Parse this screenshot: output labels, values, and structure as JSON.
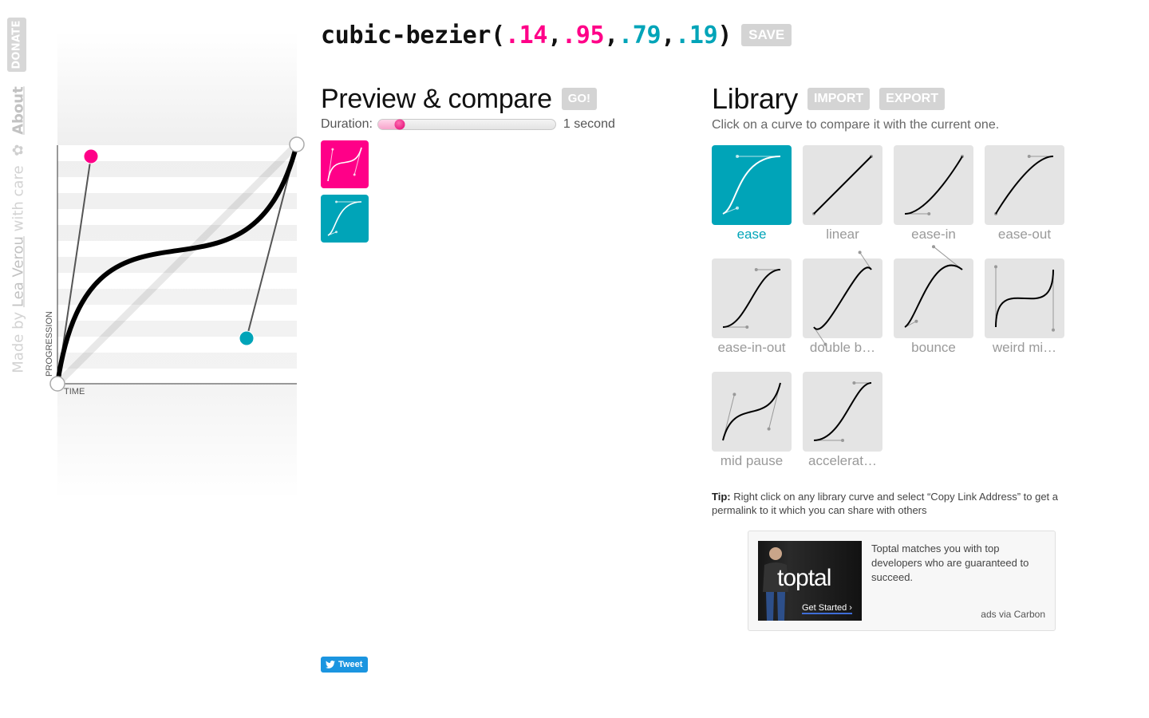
{
  "sidebar": {
    "donate_label": "DONATE",
    "credits_prefix": "Made by",
    "author_link": "Lea Verou",
    "credits_suffix": "with care",
    "flower": "✿",
    "about_link": "About"
  },
  "bezier": {
    "prefix": "cubic-bezier(",
    "p1x": ".14",
    "p1y": ".95",
    "p2x": ".79",
    "p2y": ".19",
    "sep": ",",
    "suffix": ")",
    "values": [
      0.14,
      0.95,
      0.79,
      0.19
    ],
    "save_label": "SAVE"
  },
  "editor": {
    "xlabel": "TIME",
    "ylabel": "PROGRESSION"
  },
  "preview": {
    "heading": "Preview & compare",
    "go_label": "GO!",
    "duration_label": "Duration:",
    "duration_value_text": "1 second",
    "duration_slider_fraction": 0.12,
    "tiles": [
      {
        "name": "current",
        "color": "#ff0088",
        "curve": [
          0.14,
          0.95,
          0.79,
          0.19
        ]
      },
      {
        "name": "compare",
        "color": "#00a4b8",
        "curve": [
          0.25,
          0.1,
          0.25,
          1
        ]
      }
    ]
  },
  "library": {
    "heading": "Library",
    "import_label": "IMPORT",
    "export_label": "EXPORT",
    "subtitle": "Click on a curve to compare it with the current one.",
    "items": [
      {
        "label": "ease",
        "curve": [
          0.25,
          0.1,
          0.25,
          1
        ],
        "active": true
      },
      {
        "label": "linear",
        "curve": [
          0,
          0,
          1,
          1
        ],
        "active": false
      },
      {
        "label": "ease-in",
        "curve": [
          0.42,
          0,
          1,
          1
        ],
        "active": false
      },
      {
        "label": "ease-out",
        "curve": [
          0,
          0,
          0.58,
          1
        ],
        "active": false
      },
      {
        "label": "ease-in-out",
        "curve": [
          0.42,
          0,
          0.58,
          1
        ],
        "active": false
      },
      {
        "label": "double b…",
        "curve": [
          0.2,
          -0.3,
          0.8,
          1.3
        ],
        "active": false
      },
      {
        "label": "bounce",
        "curve": [
          0.2,
          0.1,
          0.5,
          1.4
        ],
        "active": false
      },
      {
        "label": "weird mi…",
        "curve": [
          0,
          1.05,
          1,
          -0.05
        ],
        "active": false
      },
      {
        "label": "mid pause",
        "curve": [
          0.2,
          0.8,
          0.8,
          0.2
        ],
        "active": false
      },
      {
        "label": "accelerat…",
        "curve": [
          0.5,
          0,
          0.7,
          1
        ],
        "active": false
      }
    ],
    "tip_bold": "Tip:",
    "tip_text": " Right click on any library curve and select “Copy Link Address” to get a permalink to it which you can share with others"
  },
  "ad": {
    "logo_text": "toptal",
    "cta": "Get Started ›",
    "text": "Toptal matches you with top developers who are guaranteed to succeed.",
    "via": "ads via Carbon"
  },
  "tweet": {
    "label": "Tweet"
  },
  "colors": {
    "pink": "#ff0088",
    "teal": "#00a4b8",
    "button_gray": "#d4d4d4",
    "tile_gray": "#e4e4e4"
  }
}
